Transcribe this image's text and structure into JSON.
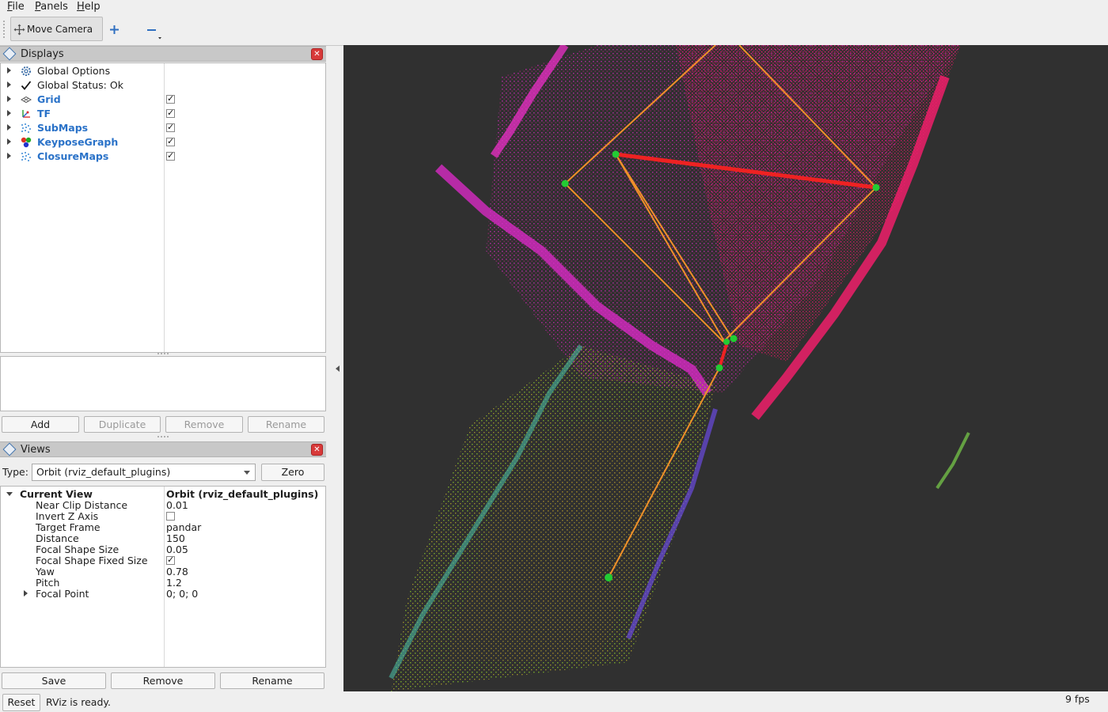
{
  "menu": {
    "items": [
      {
        "mnemonic": "F",
        "rest": "ile"
      },
      {
        "mnemonic": "P",
        "rest": "anels"
      },
      {
        "mnemonic": "H",
        "rest": "elp"
      }
    ]
  },
  "toolbar": {
    "move_camera_label": "Move Camera",
    "add_icon": "plus-icon",
    "remove_icon": "minus-icon"
  },
  "displays_panel": {
    "title": "Displays",
    "items": [
      {
        "label": "Global Options",
        "icon": "gear-icon",
        "checkbox": null
      },
      {
        "label": "Global Status: Ok",
        "icon": "checkmark-icon",
        "checkbox": null
      },
      {
        "label": "Grid",
        "icon": "grid-icon",
        "checkbox": true
      },
      {
        "label": "TF",
        "icon": "tf-axes-icon",
        "checkbox": true
      },
      {
        "label": "SubMaps",
        "icon": "pointcloud-icon",
        "checkbox": true
      },
      {
        "label": "KeyposeGraph",
        "icon": "marker-icon",
        "checkbox": true
      },
      {
        "label": "ClosureMaps",
        "icon": "pointcloud-icon",
        "checkbox": true
      }
    ],
    "buttons": {
      "add": "Add",
      "duplicate": "Duplicate",
      "remove": "Remove",
      "rename": "Rename"
    }
  },
  "views_panel": {
    "title": "Views",
    "type_label": "Type:",
    "type_value": "Orbit (rviz_default_plugins)",
    "zero_label": "Zero",
    "current_view": {
      "label": "Current View",
      "value": "Orbit (rviz_default_plugins)",
      "properties": [
        {
          "label": "Near Clip Distance",
          "value": "0.01"
        },
        {
          "label": "Invert Z Axis",
          "checkbox": false
        },
        {
          "label": "Target Frame",
          "value": "pandar"
        },
        {
          "label": "Distance",
          "value": "150"
        },
        {
          "label": "Focal Shape Size",
          "value": "0.05"
        },
        {
          "label": "Focal Shape Fixed Size",
          "checkbox": true
        },
        {
          "label": "Yaw",
          "value": "0.78"
        },
        {
          "label": "Pitch",
          "value": "1.2"
        },
        {
          "label": "Focal Point",
          "value": "0; 0; 0"
        }
      ]
    },
    "buttons": {
      "save": "Save",
      "remove": "Remove",
      "rename": "Rename"
    }
  },
  "status_bar": {
    "reset_label": "Reset",
    "message": "RViz is ready.",
    "fps": "9 fps"
  },
  "colors": {
    "viewport_bg": "#303030",
    "graph_edge": "#f0902a",
    "loop_closure_edge": "#ee2222",
    "keyframe_node": "#22cc33",
    "display_name_blue": "#2a72c8"
  }
}
